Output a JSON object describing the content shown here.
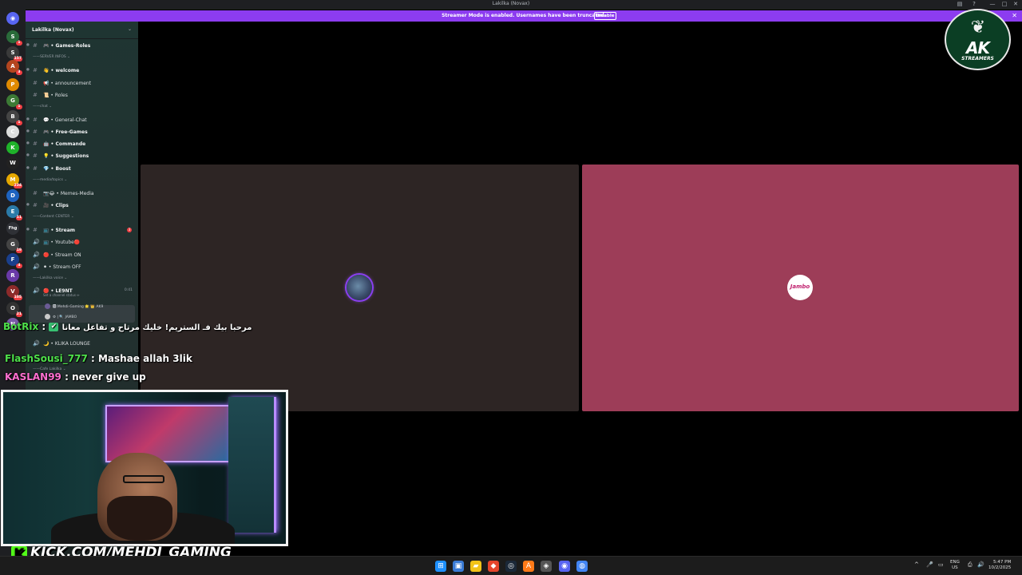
{
  "window": {
    "title": "Lakilka (Novax)",
    "controls": [
      "—",
      "□",
      "✕"
    ]
  },
  "banner": {
    "message": "Streamer Mode is enabled. Usernames have been truncated.",
    "button": "Disable",
    "close": "✕"
  },
  "rail": {
    "servers": [
      {
        "glyph": "◉",
        "color": "#5865f2",
        "badge": ""
      },
      {
        "glyph": "S",
        "color": "#2a6b3a",
        "badge": "1"
      },
      {
        "glyph": "S",
        "color": "#3a3a3a",
        "badge": "157"
      },
      {
        "glyph": "A",
        "color": "#b4451f",
        "badge": "3"
      },
      {
        "glyph": "P",
        "color": "#e08a00",
        "badge": ""
      },
      {
        "glyph": "G",
        "color": "#3c7a35",
        "badge": "1"
      },
      {
        "glyph": "B",
        "color": "#444",
        "badge": "1"
      },
      {
        "glyph": "C",
        "color": "#dddddd",
        "badge": ""
      },
      {
        "glyph": "K",
        "color": "#1fb22a",
        "badge": ""
      },
      {
        "glyph": "W",
        "color": "#222",
        "badge": ""
      },
      {
        "glyph": "M",
        "color": "#e6a800",
        "badge": "234"
      },
      {
        "glyph": "D",
        "color": "#1e63c0",
        "badge": ""
      },
      {
        "glyph": "E",
        "color": "#2b7aa8",
        "badge": "11"
      },
      {
        "glyph": "Fhg",
        "color": "#2f3136",
        "badge": ""
      },
      {
        "glyph": "G",
        "color": "#444",
        "badge": "19"
      },
      {
        "glyph": "F",
        "color": "#1a3f8c",
        "badge": "4"
      },
      {
        "glyph": "R",
        "color": "#6a3aa8",
        "badge": ""
      },
      {
        "glyph": "V",
        "color": "#8c2a2a",
        "badge": "105"
      },
      {
        "glyph": "O",
        "color": "#333",
        "badge": "21"
      },
      {
        "glyph": "N",
        "color": "#7a5aa8",
        "badge": ""
      }
    ]
  },
  "sidebar": {
    "server_name": "Lakilka (Novax)",
    "chevron": "⌄",
    "rows": [
      {
        "kind": "channel",
        "label": "🎮 • Games-Roles",
        "bold": true,
        "arrow": true
      },
      {
        "kind": "category",
        "label": "——SERVER INFOS ⌄"
      },
      {
        "kind": "channel",
        "label": "👋 • welcome",
        "bold": true,
        "arrow": true
      },
      {
        "kind": "channel",
        "label": "📢 • announcement",
        "bold": false,
        "arrow": false
      },
      {
        "kind": "channel",
        "label": "📜 • Roles",
        "bold": false,
        "arrow": false
      },
      {
        "kind": "category",
        "label": "——chat ⌄"
      },
      {
        "kind": "channel",
        "label": "💬 • General-Chat",
        "bold": false,
        "arrow": true
      },
      {
        "kind": "channel",
        "label": "🎮 • Free-Games",
        "bold": true,
        "arrow": true
      },
      {
        "kind": "channel",
        "label": "🤖 • Commande",
        "bold": true,
        "arrow": true
      },
      {
        "kind": "channel",
        "label": "💡 • Suggestions",
        "bold": true,
        "arrow": true
      },
      {
        "kind": "channel",
        "label": "💎 • Boost",
        "bold": true,
        "arrow": true
      },
      {
        "kind": "category",
        "label": "——media/topics ⌄"
      },
      {
        "kind": "channel",
        "label": "📷😂 • Memes-Media",
        "bold": false,
        "arrow": false
      },
      {
        "kind": "channel",
        "label": "🎥 • Clips",
        "bold": true,
        "arrow": true
      },
      {
        "kind": "category",
        "label": "——Content CENTER ⌄"
      },
      {
        "kind": "channel",
        "label": "📺 • Stream",
        "bold": true,
        "arrow": true,
        "mention": "3"
      },
      {
        "kind": "voice",
        "label": "📺 • Youtube🔴",
        "bold": false
      },
      {
        "kind": "voice",
        "label": "🔴 • Stream ON",
        "bold": false
      },
      {
        "kind": "voice",
        "label": "⚫ • Stream OFF",
        "bold": false
      },
      {
        "kind": "category",
        "label": "——Lakilka voice ⌄"
      }
    ],
    "active_voice": {
      "label": "🔴 • LE9NT",
      "status": "Set a channel status ✏",
      "time": "0:41",
      "users": [
        "🅼 Mehdi-Gaming 🌟 👑 AK9",
        "⚙ | 🔍 JAMBO"
      ]
    },
    "lounge": {
      "label": "🌙 • KLIKA LOUNGE"
    },
    "cafe_category": "——Cafe Lakilka ⌄"
  },
  "call": {
    "tile_a": {
      "avatar": "avatar-user-a"
    },
    "tile_b": {
      "avatar_text": "Jambo"
    }
  },
  "logo": {
    "wings": "❦",
    "text": "AK",
    "subtext": "STREAMERS"
  },
  "chat_overlay": [
    {
      "user": "BotRix",
      "user_color": "#4ee04a",
      "badge": "✔",
      "separator": " : ",
      "message": "مرحبا بيك فـ الستريم! خليك مرتاح و تفاعل معانا"
    },
    {
      "user": "FlashSousi_777",
      "user_color": "#4ee04a",
      "badge": "",
      "separator": " : ",
      "message": "Mashae allah 3lik"
    },
    {
      "user": "KASLAN99",
      "user_color": "#ff6fd0",
      "badge": "",
      "separator": " : ",
      "message": "never give up"
    }
  ],
  "kick_brand": {
    "k": "K",
    "url": "KICK.COM/MEHDI_GAMING"
  },
  "taskbar": {
    "apps": [
      {
        "glyph": "⊞",
        "color": "#1e90ff"
      },
      {
        "glyph": "▣",
        "color": "#3a7bd5"
      },
      {
        "glyph": "▰",
        "color": "#f2c318"
      },
      {
        "glyph": "◆",
        "color": "#e5452c"
      },
      {
        "glyph": "◎",
        "color": "#1b2838"
      },
      {
        "glyph": "A",
        "color": "#ff7a18"
      },
      {
        "glyph": "◈",
        "color": "#555"
      },
      {
        "glyph": "◉",
        "color": "#5865f2"
      },
      {
        "glyph": "◍",
        "color": "#4285f4"
      }
    ],
    "tray": [
      "^",
      "🎤",
      "▭",
      "⎙",
      "🔊"
    ],
    "lang_top": "ENG",
    "lang_bottom": "US",
    "time": "5:47 PM",
    "date": "10/2/2025"
  }
}
